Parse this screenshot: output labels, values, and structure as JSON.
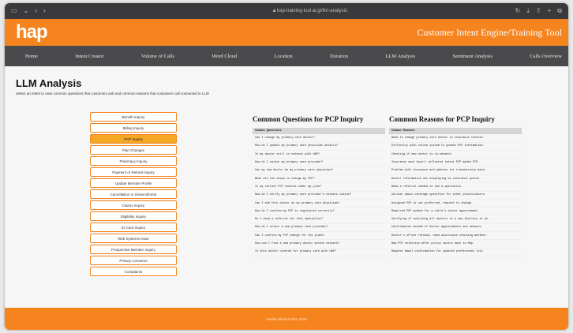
{
  "browser": {
    "url": "hap-training-tool.ai.gl/llm-analysis"
  },
  "brand": {
    "logo": "hap",
    "title": "Customer Intent Engine/Training Tool"
  },
  "nav": {
    "items": [
      "Home",
      "Intent Creator",
      "Volume of Calls",
      "Word Cloud",
      "Location",
      "Duration",
      "LLM Analysis",
      "Sentiment Analysis",
      "Calls Overview"
    ]
  },
  "page": {
    "title": "LLM Analysis",
    "subtitle": "Select an intent to view common questions that customers ask and common reasons that customers call connected to LLM"
  },
  "intents": {
    "items": [
      "Benefit Inquiry",
      "Billing Inquiry",
      "PCP Inquiry",
      "Plan Changes",
      "Pharmacy Inquiry",
      "Payment or Refund Inquiry",
      "Update Member Profile",
      "Cancellation or Disenrollment",
      "Claims Inquiry",
      "Eligibility Inquiry",
      "ID Card Inquiry",
      "Web Systems Issue",
      "Prospective Member Inquiry",
      "Privacy Concerns",
      "Complaints"
    ],
    "active_index": 2
  },
  "questions": {
    "heading": "Common Questions for PCP Inquiry",
    "column": "Common Questions",
    "rows": [
      "Can I change my primary care doctor?",
      "How do I update my primary care physician details?",
      "Is my doctor still in network with HAP?",
      "How do I switch my primary care provider?",
      "Can my new doctor be my primary care physician?",
      "What are the steps to change my PCP?",
      "Is my current PCP covered under my plan?",
      "How do I verify my primary care provider's network status?",
      "Can I add this doctor as my primary care physician?",
      "How do I confirm my PCP is registered correctly?",
      "Do I need a referral for this specialist?",
      "How do I select a new primary care provider?",
      "Can I confirm my PCP change for the plans?",
      "How can I find a new primary doctor within network?",
      "Is this doctor covered for primary care with HAP?"
    ]
  },
  "reasons": {
    "heading": "Common Reasons for PCP Inquiry",
    "column": "Common Reasons",
    "rows": [
      "Need to change primary care doctor in insurance records.",
      "Difficulty with online system to update PCP information.",
      "Checking if new doctor is in-network.",
      "Insurance card hasn't reflected latest PCP added PCP.",
      "Problem with insurance and address for transmission data.",
      "Doctor information not displaying on insurance portal.",
      "Need a referral needed to see a specialist.",
      "Unclear about coverage specifics for other practitioners.",
      "Assigned PCP is not preferred, request to change.",
      "Required PCP update for a child's doctor appointment.",
      "Verifying if switching all doctors to a new facility is ok.",
      "Confirmation needed of doctor appointments and network.",
      "Doctor's office refused, need assistance choosing another.",
      "New PCP selection after policy switch back to Map.",
      "Request email confirmation for updated preferences list."
    ]
  },
  "footer": {
    "text": "Health Alliance Plan 2025"
  }
}
